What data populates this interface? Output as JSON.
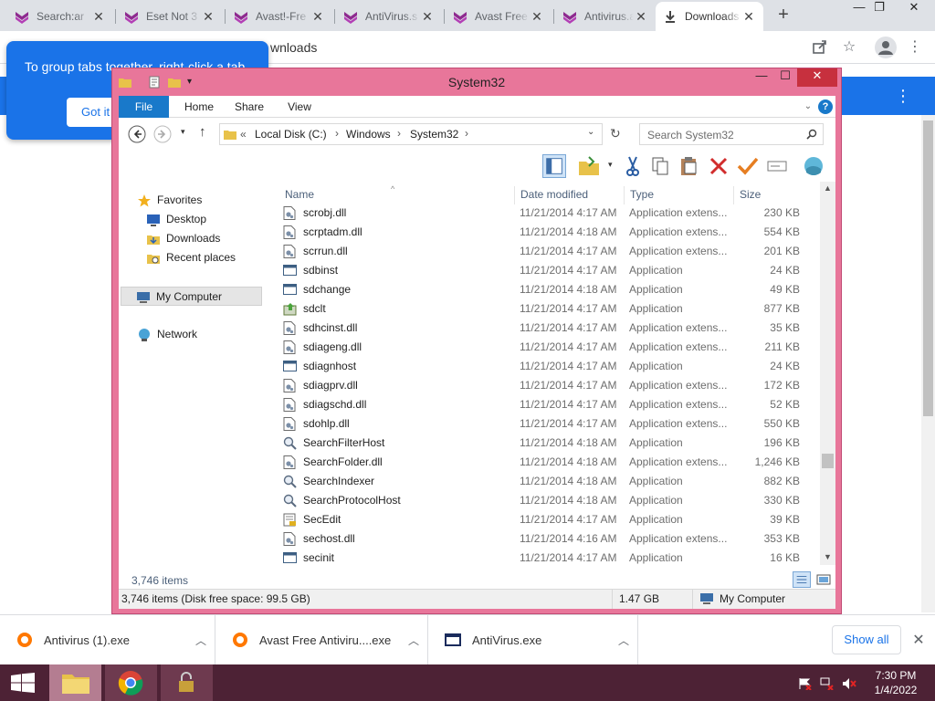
{
  "browser": {
    "tabs": [
      {
        "title": "Search:ar",
        "close": "✕",
        "active": false
      },
      {
        "title": "Eset Not 3",
        "close": "✕",
        "active": false
      },
      {
        "title": "Avast!-Fre",
        "close": "✕",
        "active": false
      },
      {
        "title": "AntiVirus.s",
        "close": "✕",
        "active": false
      },
      {
        "title": "Avast Free",
        "close": "✕",
        "active": false
      },
      {
        "title": "Antivirus.a",
        "close": "✕",
        "active": false
      },
      {
        "title": "Downloads",
        "close": "✕",
        "active": true
      }
    ],
    "new_tab": "+",
    "address_fragment": "wnloads",
    "window_controls": {
      "min": "—",
      "max": "❐",
      "close": "✕"
    },
    "tooltip": {
      "text": "To group tabs together, right-click a tab",
      "button": "Got it"
    }
  },
  "explorer": {
    "title": "System32",
    "window_controls": {
      "min": "—",
      "max": "☐",
      "close": "✕"
    },
    "ribbon_tabs": [
      "File",
      "Home",
      "Share",
      "View"
    ],
    "breadcrumb": {
      "prefix": "«",
      "parts": [
        "Local Disk (C:)",
        "Windows",
        "System32"
      ],
      "sep": "›"
    },
    "search_placeholder": "Search System32",
    "nav": {
      "favorites": "Favorites",
      "desktop": "Desktop",
      "downloads": "Downloads",
      "recent": "Recent places",
      "computer": "My Computer",
      "network": "Network"
    },
    "columns": {
      "name": "Name",
      "date": "Date modified",
      "type": "Type",
      "size": "Size"
    },
    "files": [
      {
        "name": "scrobj.dll",
        "date": "11/21/2014 4:17 AM",
        "type": "Application extens...",
        "size": "230 KB",
        "icon": "dll"
      },
      {
        "name": "scrptadm.dll",
        "date": "11/21/2014 4:18 AM",
        "type": "Application extens...",
        "size": "554 KB",
        "icon": "dll"
      },
      {
        "name": "scrrun.dll",
        "date": "11/21/2014 4:17 AM",
        "type": "Application extens...",
        "size": "201 KB",
        "icon": "dll"
      },
      {
        "name": "sdbinst",
        "date": "11/21/2014 4:17 AM",
        "type": "Application",
        "size": "24 KB",
        "icon": "app"
      },
      {
        "name": "sdchange",
        "date": "11/21/2014 4:18 AM",
        "type": "Application",
        "size": "49 KB",
        "icon": "app"
      },
      {
        "name": "sdclt",
        "date": "11/21/2014 4:17 AM",
        "type": "Application",
        "size": "877 KB",
        "icon": "backup"
      },
      {
        "name": "sdhcinst.dll",
        "date": "11/21/2014 4:17 AM",
        "type": "Application extens...",
        "size": "35 KB",
        "icon": "dll"
      },
      {
        "name": "sdiageng.dll",
        "date": "11/21/2014 4:17 AM",
        "type": "Application extens...",
        "size": "211 KB",
        "icon": "dll"
      },
      {
        "name": "sdiagnhost",
        "date": "11/21/2014 4:17 AM",
        "type": "Application",
        "size": "24 KB",
        "icon": "app"
      },
      {
        "name": "sdiagprv.dll",
        "date": "11/21/2014 4:17 AM",
        "type": "Application extens...",
        "size": "172 KB",
        "icon": "dll"
      },
      {
        "name": "sdiagschd.dll",
        "date": "11/21/2014 4:17 AM",
        "type": "Application extens...",
        "size": "52 KB",
        "icon": "dll"
      },
      {
        "name": "sdohlp.dll",
        "date": "11/21/2014 4:17 AM",
        "type": "Application extens...",
        "size": "550 KB",
        "icon": "dll"
      },
      {
        "name": "SearchFilterHost",
        "date": "11/21/2014 4:18 AM",
        "type": "Application",
        "size": "196 KB",
        "icon": "search"
      },
      {
        "name": "SearchFolder.dll",
        "date": "11/21/2014 4:18 AM",
        "type": "Application extens...",
        "size": "1,246 KB",
        "icon": "dll"
      },
      {
        "name": "SearchIndexer",
        "date": "11/21/2014 4:18 AM",
        "type": "Application",
        "size": "882 KB",
        "icon": "search"
      },
      {
        "name": "SearchProtocolHost",
        "date": "11/21/2014 4:18 AM",
        "type": "Application",
        "size": "330 KB",
        "icon": "search"
      },
      {
        "name": "SecEdit",
        "date": "11/21/2014 4:17 AM",
        "type": "Application",
        "size": "39 KB",
        "icon": "secedit"
      },
      {
        "name": "sechost.dll",
        "date": "11/21/2014 4:16 AM",
        "type": "Application extens...",
        "size": "353 KB",
        "icon": "dll"
      },
      {
        "name": "secinit",
        "date": "11/21/2014 4:17 AM",
        "type": "Application",
        "size": "16 KB",
        "icon": "app"
      }
    ],
    "item_count": "3,746 items",
    "status": {
      "left": "3,746 items (Disk free space: 99.5 GB)",
      "size": "1.47 GB",
      "location": "My Computer"
    }
  },
  "downloads_shelf": {
    "items": [
      {
        "name": "Antivirus (1).exe",
        "icon": "avast-orange"
      },
      {
        "name": "Avast Free Antiviru....exe",
        "icon": "avast-orange"
      },
      {
        "name": "AntiVirus.exe",
        "icon": "window"
      }
    ],
    "show_all": "Show all",
    "close": "✕"
  },
  "taskbar": {
    "time": "7:30 PM",
    "date": "1/4/2022"
  },
  "colors": {
    "explorer_frame": "#e8769a",
    "taskbar": "#4d2235",
    "chrome_blue": "#1a73e8",
    "ribbon_file": "#1979ca"
  }
}
